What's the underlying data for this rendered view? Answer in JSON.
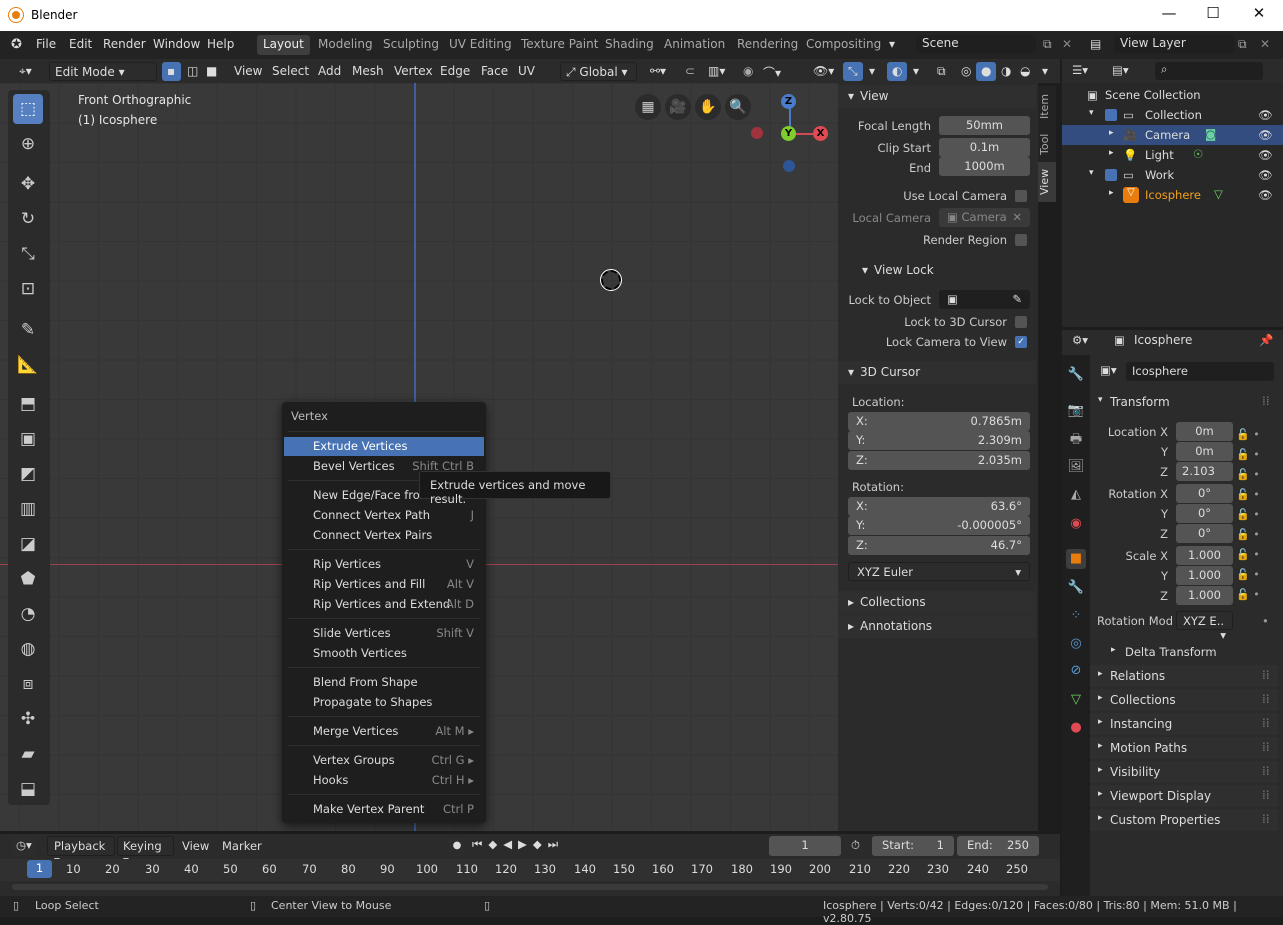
{
  "window": {
    "title": "Blender",
    "minimize": "—",
    "maximize": "☐",
    "close": "✕"
  },
  "menubar": [
    "File",
    "Edit",
    "Render",
    "Window",
    "Help"
  ],
  "workspaces": [
    "Layout",
    "Modeling",
    "Sculpting",
    "UV Editing",
    "Texture Paint",
    "Shading",
    "Animation",
    "Rendering",
    "Compositing"
  ],
  "scene": {
    "label": "Scene",
    "view_layer": "View Layer"
  },
  "header": {
    "mode": "Edit Mode",
    "menus": [
      "View",
      "Select",
      "Add",
      "Mesh",
      "Vertex",
      "Edge",
      "Face",
      "UV"
    ],
    "transform_orientation": "Global"
  },
  "viewport": {
    "view_name": "Front Orthographic",
    "object_label": "(1) Icosphere",
    "gizmo": {
      "z": "Z",
      "y": "Y",
      "x": "X"
    }
  },
  "npanel": {
    "tabs": [
      "Item",
      "Tool",
      "View"
    ],
    "view_section": "View",
    "focal_length_label": "Focal Length",
    "focal_length": "50mm",
    "clip_start_label": "Clip Start",
    "clip_start": "0.1m",
    "end_label": "End",
    "end": "1000m",
    "use_local_camera": "Use Local Camera",
    "local_camera_label": "Local Camera",
    "local_camera": "Camera",
    "render_region": "Render Region",
    "view_lock": "View Lock",
    "lock_to_object": "Lock to Object",
    "lock_to_cursor": "Lock to 3D Cursor",
    "lock_camera": "Lock Camera to View",
    "cursor_section": "3D Cursor",
    "location_label": "Location:",
    "loc": [
      {
        "axis": "X:",
        "value": "0.7865m"
      },
      {
        "axis": "Y:",
        "value": "2.309m"
      },
      {
        "axis": "Z:",
        "value": "2.035m"
      }
    ],
    "rotation_label": "Rotation:",
    "rot": [
      {
        "axis": "X:",
        "value": "63.6°"
      },
      {
        "axis": "Y:",
        "value": "-0.000005°"
      },
      {
        "axis": "Z:",
        "value": "46.7°"
      }
    ],
    "rotation_mode": "XYZ Euler",
    "collections": "Collections",
    "annotations": "Annotations"
  },
  "outliner": {
    "rows": [
      {
        "name": "Scene Collection"
      },
      {
        "name": "Collection"
      },
      {
        "name": "Camera"
      },
      {
        "name": "Light"
      },
      {
        "name": "Work"
      },
      {
        "name": "Icosphere"
      }
    ]
  },
  "properties": {
    "object_name": "Icosphere",
    "data_name": "Icosphere",
    "transform": "Transform",
    "location_x_label": "Location X",
    "y_label": "Y",
    "z_label": "Z",
    "location": [
      "0m",
      "0m",
      "2.103"
    ],
    "rotation_x_label": "Rotation X",
    "rotation": [
      "0°",
      "0°",
      "0°"
    ],
    "scale_x_label": "Scale X",
    "scale": [
      "1.000",
      "1.000",
      "1.000"
    ],
    "rotation_mode_label": "Rotation Mod",
    "rotation_mode": "XYZ E..",
    "delta": "Delta Transform",
    "sections": [
      "Relations",
      "Collections",
      "Instancing",
      "Motion Paths",
      "Visibility",
      "Viewport Display",
      "Custom Properties"
    ]
  },
  "context_menu": {
    "title": "Vertex",
    "items": [
      {
        "label": "Extrude Vertices",
        "shortcut": ""
      },
      {
        "label": "Bevel Vertices",
        "shortcut": "Shift Ctrl B"
      },
      {
        "label": "New Edge/Face from Vertices",
        "shortcut": ""
      },
      {
        "label": "Connect Vertex Path",
        "shortcut": "J"
      },
      {
        "label": "Connect Vertex Pairs",
        "shortcut": ""
      },
      {
        "label": "Rip Vertices",
        "shortcut": "V"
      },
      {
        "label": "Rip Vertices and Fill",
        "shortcut": "Alt V"
      },
      {
        "label": "Rip Vertices and Extend",
        "shortcut": "Alt D"
      },
      {
        "label": "Slide Vertices",
        "shortcut": "Shift V"
      },
      {
        "label": "Smooth Vertices",
        "shortcut": ""
      },
      {
        "label": "Blend From Shape",
        "shortcut": ""
      },
      {
        "label": "Propagate to Shapes",
        "shortcut": ""
      },
      {
        "label": "Merge Vertices",
        "shortcut": "Alt M ▸"
      },
      {
        "label": "Vertex Groups",
        "shortcut": "Ctrl G ▸"
      },
      {
        "label": "Hooks",
        "shortcut": "Ctrl H ▸"
      },
      {
        "label": "Make Vertex Parent",
        "shortcut": "Ctrl P"
      }
    ],
    "tooltip": "Extrude vertices and move result."
  },
  "timeline": {
    "menus": [
      "Playback",
      "Keying",
      "View",
      "Marker"
    ],
    "current_frame": "1",
    "start_label": "Start:",
    "start": "1",
    "end_label": "End:",
    "end": "250",
    "ticks": [
      "1",
      "10",
      "20",
      "30",
      "40",
      "50",
      "60",
      "70",
      "80",
      "90",
      "100",
      "110",
      "120",
      "130",
      "140",
      "150",
      "160",
      "170",
      "180",
      "190",
      "200",
      "210",
      "220",
      "230",
      "240",
      "250"
    ]
  },
  "status": {
    "left": "Loop Select",
    "middle": "Center View to Mouse",
    "stats": "Icosphere | Verts:0/42 | Edges:0/120 | Faces:0/80 | Tris:80 | Mem: 51.0 MB | v2.80.75"
  }
}
